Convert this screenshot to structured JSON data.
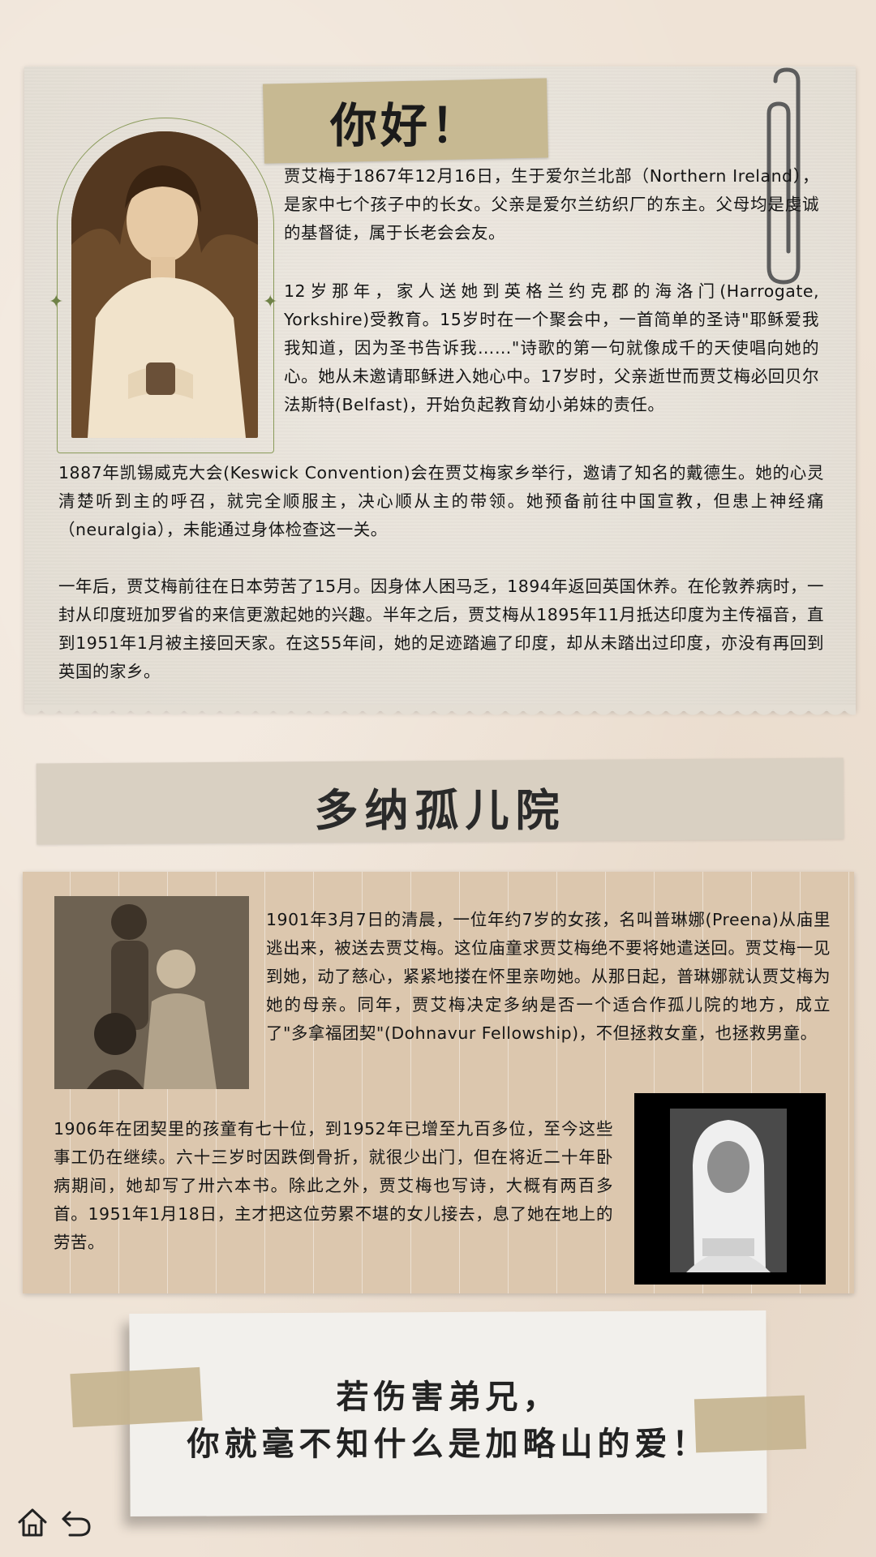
{
  "section1": {
    "title": "你好！",
    "para1": "贾艾梅于1867年12月16日，生于爱尔兰北部（Northern Ireland），是家中七个孩子中的长女。父亲是爱尔兰纺织厂的东主。父母均是虔诚的基督徒，属于长老会会友。",
    "para2": "12岁那年，家人送她到英格兰约克郡的海洛门(Harrogate, Yorkshire)受教育。15岁时在一个聚会中，一首简单的圣诗\"耶稣爱我我知道，因为圣书告诉我……\"诗歌的第一句就像成千的天使唱向她的心。她从未邀请耶稣进入她心中。17岁时，父亲逝世而贾艾梅必回贝尔法斯特(Belfast)，开始负起教育幼小弟妹的责任。",
    "para3": "1887年凯锡威克大会(Keswick Convention)会在贾艾梅家乡举行，邀请了知名的戴德生。她的心灵清楚听到主的呼召，就完全顺服主，决心顺从主的带领。她预备前往中国宣教，但患上神经痛（neuralgia），未能通过身体检查这一关。",
    "para4": "一年后，贾艾梅前往在日本劳苦了15月。因身体人困马乏，1894年返回英国休养。在伦敦养病时，一封从印度班加罗省的来信更激起她的兴趣。半年之后，贾艾梅从1895年11月抵达印度为主传福音，直到1951年1月被主接回天家。在这55年间，她的足迹踏遍了印度，却从未踏出过印度，亦没有再回到英国的家乡。"
  },
  "section2": {
    "title": "多纳孤儿院",
    "para1": "1901年3月7日的清晨，一位年约7岁的女孩，名叫普琳娜(Preena)从庙里逃出来，被送去贾艾梅。这位庙童求贾艾梅绝不要将她遣送回。贾艾梅一见到她，动了慈心，紧紧地搂在怀里亲吻她。从那日起，普琳娜就认贾艾梅为她的母亲。同年，贾艾梅决定多纳是否一个适合作孤儿院的地方，成立了\"多拿福团契\"(Dohnavur Fellowship)，不但拯救女童，也拯救男童。",
    "para2": "1906年在团契里的孩童有七十位，到1952年已增至九百多位，至今这些事工仍在继续。六十三岁时因跌倒骨折，就很少出门，但在将近二十年卧病期间，她却写了卅六本书。除此之外，贾艾梅也写诗，大概有两百多首。1951年1月18日，主才把这位劳累不堪的女儿接去，息了她在地上的劳苦。"
  },
  "quote": {
    "line1": "若伤害弟兄，",
    "line2": "你就毫不知什么是加略山的爱！"
  },
  "nav": {
    "home_icon": "home-icon",
    "back_icon": "back-icon"
  }
}
